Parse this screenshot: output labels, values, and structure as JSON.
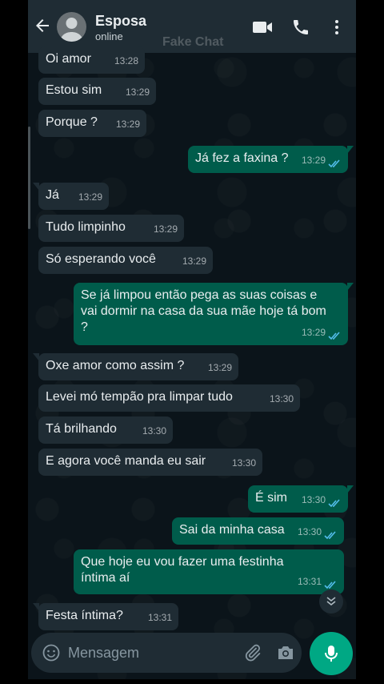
{
  "header": {
    "contact_name": "Esposa",
    "contact_status": "online",
    "watermark": "Fake Chat",
    "icons": [
      "back-arrow-icon",
      "avatar-icon",
      "video-call-icon",
      "voice-call-icon",
      "more-options-icon"
    ]
  },
  "messages": [
    {
      "dir": "in",
      "text": "Oi amor",
      "time": "13:28"
    },
    {
      "dir": "in",
      "text": "Estou sim",
      "time": "13:29"
    },
    {
      "dir": "in",
      "text": "Porque ?",
      "time": "13:29"
    },
    {
      "dir": "out",
      "text": "Já fez a faxina ?",
      "time": "13:29",
      "status": "read"
    },
    {
      "dir": "in",
      "text": "Já",
      "time": "13:29"
    },
    {
      "dir": "in",
      "text": "Tudo limpinho",
      "time": "13:29"
    },
    {
      "dir": "in",
      "text": "Só esperando você",
      "time": "13:29"
    },
    {
      "dir": "out",
      "text": "Se já limpou então pega as suas coisas e vai dormir na casa da sua mãe hoje tá bom ?",
      "time": "13:29",
      "status": "read"
    },
    {
      "dir": "in",
      "text": "Oxe amor como assim ?",
      "time": "13:29"
    },
    {
      "dir": "in",
      "text": "Levei mó tempão pra limpar tudo",
      "time": "13:30"
    },
    {
      "dir": "in",
      "text": "Tá brilhando",
      "time": "13:30"
    },
    {
      "dir": "in",
      "text": "E agora você manda eu sair",
      "time": "13:30"
    },
    {
      "dir": "out",
      "text": "É sim",
      "time": "13:30",
      "status": "read"
    },
    {
      "dir": "out",
      "text": "Sai da minha casa",
      "time": "13:30",
      "status": "read"
    },
    {
      "dir": "out",
      "text": "Que hoje eu vou fazer uma festinha íntima aí",
      "time": "13:31",
      "status": "read"
    },
    {
      "dir": "in",
      "text": "Festa íntima?",
      "time": "13:31"
    }
  ],
  "composer": {
    "placeholder": "Mensagem",
    "icons": [
      "emoji-icon",
      "attach-icon",
      "camera-icon",
      "mic-icon"
    ]
  },
  "colors": {
    "background": "#0b141a",
    "header": "#1f2c34",
    "incoming_bubble": "#1f2c34",
    "outgoing_bubble": "#005c4b",
    "read_ticks": "#53bdeb",
    "accent": "#00a884"
  }
}
